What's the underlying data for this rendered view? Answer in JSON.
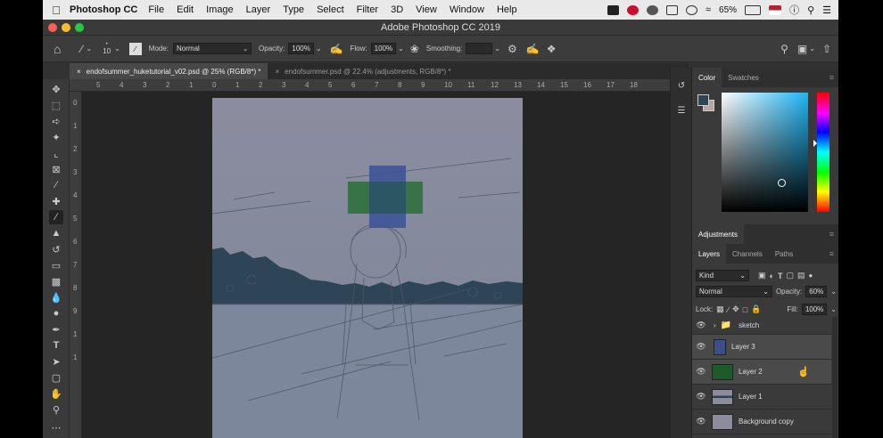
{
  "menubar": {
    "app_name": "Photoshop CC",
    "items": [
      "File",
      "Edit",
      "Image",
      "Layer",
      "Type",
      "Select",
      "Filter",
      "3D",
      "View",
      "Window",
      "Help"
    ],
    "battery": "65%"
  },
  "window": {
    "title": "Adobe Photoshop CC 2019"
  },
  "options": {
    "brush_size": "10",
    "mode_label": "Mode:",
    "mode_value": "Normal",
    "opacity_label": "Opacity:",
    "opacity_value": "100%",
    "flow_label": "Flow:",
    "flow_value": "100%",
    "smoothing_label": "Smoothing:"
  },
  "tabs": [
    {
      "label": "endofsummеr_huketutorial_v02.psd @ 25% (RGB/8*) *"
    },
    {
      "label": "endofsummer.psd @ 22.4% (adjustments, RGB/8*) *"
    }
  ],
  "ruler": {
    "h": [
      "5",
      "4",
      "3",
      "2",
      "1",
      "0",
      "1",
      "2",
      "3",
      "4",
      "5",
      "6",
      "7",
      "8",
      "9",
      "10",
      "11",
      "12",
      "13",
      "14",
      "15",
      "16",
      "17",
      "18"
    ],
    "v": [
      "0",
      "1",
      "2",
      "3",
      "4",
      "5",
      "6",
      "7",
      "8",
      "9",
      "1",
      "1"
    ]
  },
  "panels": {
    "color_tabs": [
      "Color",
      "Swatches"
    ],
    "adjustments_tab": "Adjustments",
    "layer_tabs": [
      "Layers",
      "Channels",
      "Paths"
    ],
    "kind_label": "Kind",
    "blend_mode": "Normal",
    "opacity_label": "Opacity:",
    "opacity_value": "60%",
    "lock_label": "Lock:",
    "fill_label": "Fill:",
    "fill_value": "100%"
  },
  "layers": [
    {
      "name": "sketch"
    },
    {
      "name": "Layer 3"
    },
    {
      "name": "Layer 2"
    },
    {
      "name": "Layer 1"
    },
    {
      "name": "Background copy"
    }
  ],
  "colors": {
    "foreground": "#2d4556",
    "background": "#b9a6a0",
    "layer3_thumb": "#3c4f86",
    "layer2_thumb": "#1f5a2a",
    "doc_bg": "#8b8d9d"
  }
}
